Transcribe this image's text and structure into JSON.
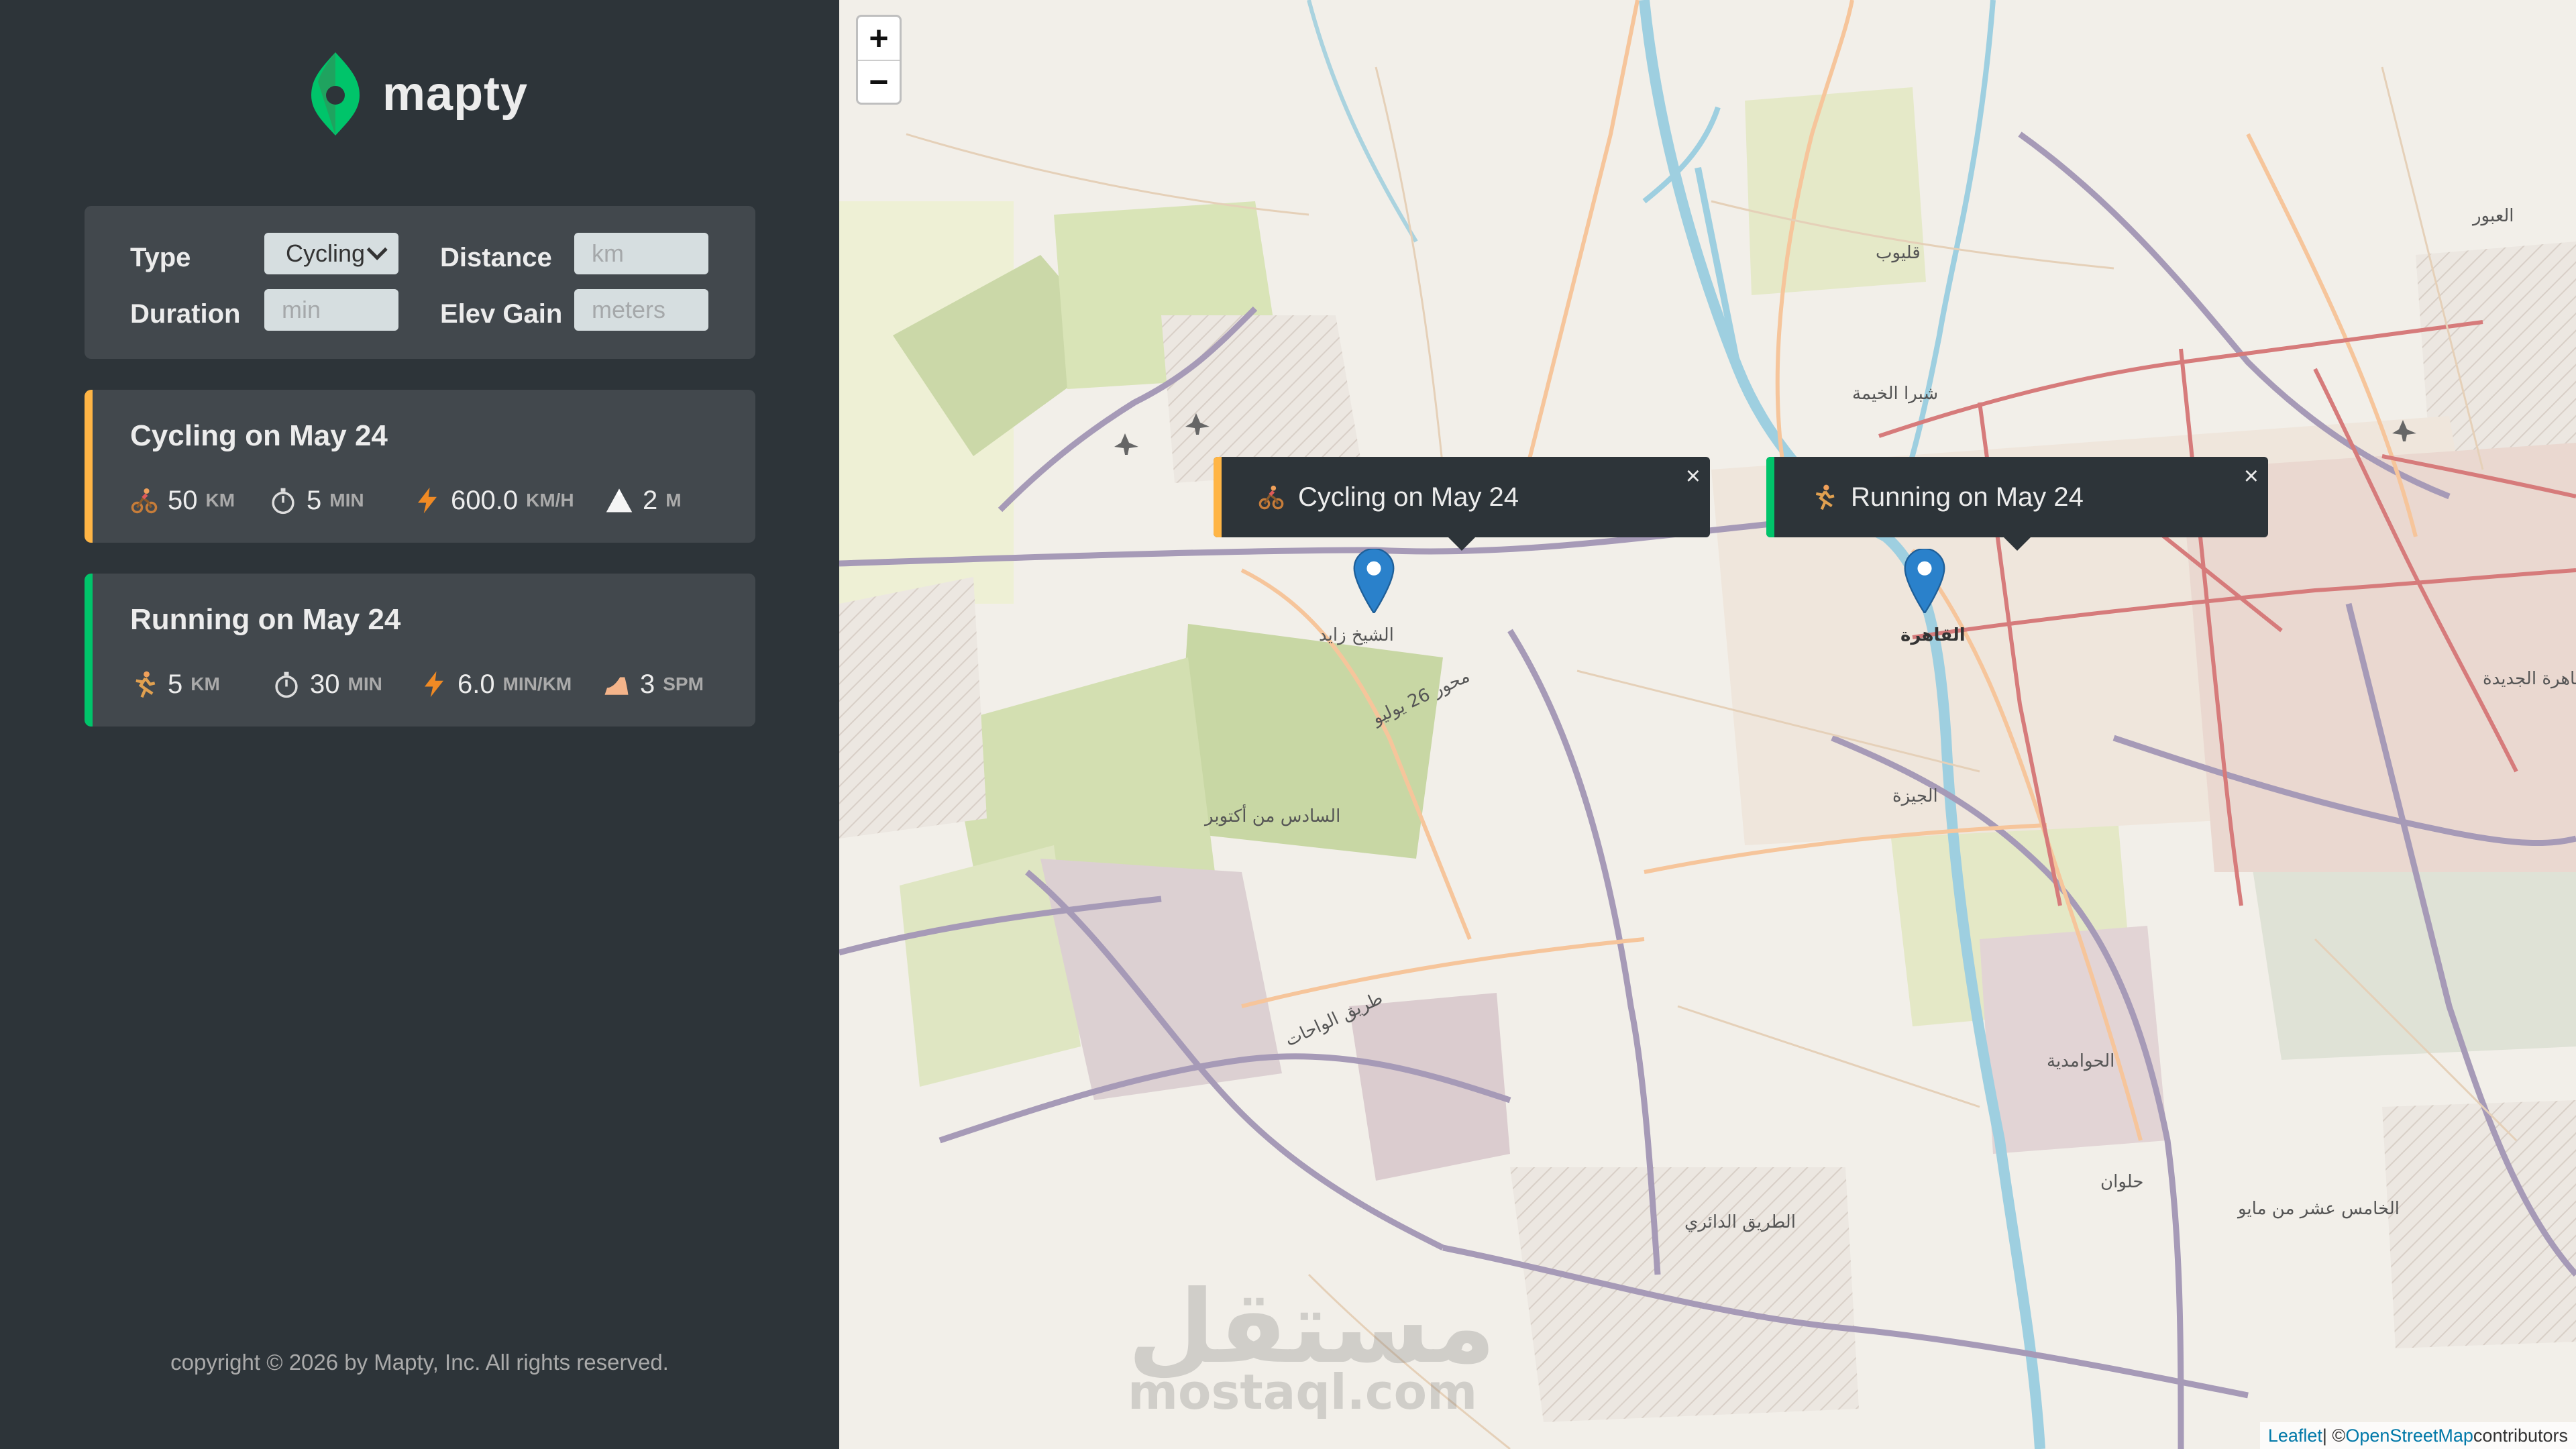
{
  "app": {
    "name": "mapty"
  },
  "form": {
    "type_label": "Type",
    "type_value": "Cycling",
    "distance_label": "Distance",
    "distance_placeholder": "km",
    "duration_label": "Duration",
    "duration_placeholder": "min",
    "elev_label": "Elev Gain",
    "elev_placeholder": "meters"
  },
  "workouts": [
    {
      "title": "Cycling on May 24",
      "accent_color": "#ffb545",
      "icon": "cyclist-icon",
      "distance": "50",
      "distance_unit": "km",
      "duration": "5",
      "duration_unit": "min",
      "speed": "600.0",
      "speed_unit": "km/h",
      "elevation": "2",
      "elevation_unit": "m"
    },
    {
      "title": "Running on May 24",
      "accent_color": "#00c46a",
      "icon": "runner-icon",
      "distance": "5",
      "distance_unit": "km",
      "duration": "30",
      "duration_unit": "min",
      "pace": "6.0",
      "pace_unit": "min/km",
      "cadence": "3",
      "cadence_unit": "spm"
    }
  ],
  "footer": {
    "copyright": "copyright © 2026 by Mapty, Inc. All rights reserved."
  },
  "map": {
    "zoom_in": "+",
    "zoom_out": "−",
    "popups": [
      {
        "title": "Cycling on May 24",
        "accent_color": "#ffb545",
        "close": "×"
      },
      {
        "title": "Running on May 24",
        "accent_color": "#00c46a",
        "close": "×"
      }
    ],
    "labels": {
      "zayed": "الشيخ زايد",
      "cairo": "القاهرة",
      "giza": "الجيزة",
      "october": "السادس من أكتوبر",
      "helwan": "حلوان",
      "shubra": "شبرا الخيمة",
      "qalyub": "قليوب",
      "ring_road": "الطريق الدائري",
      "wahat": "طريق الواحات",
      "mehwar": "محور 26 يوليو",
      "obour": "العبور",
      "new_cairo": "القاهرة الجديدة",
      "hawamdia": "الحوامدية",
      "fifth": "الخامس عشر من مايو"
    },
    "watermark": {
      "arabic": "مستقل",
      "latin": "mostaql.com"
    },
    "attribution": {
      "leaflet": "Leaflet",
      "sep": " | © ",
      "osm": "OpenStreetMap",
      "suffix": " contributors"
    }
  },
  "colors": {
    "sidebar_bg": "#2d3439",
    "card_bg": "#42484d",
    "brand_green": "#00c46a",
    "brand_yellow": "#ffb545",
    "marker_blue": "#2a81cb"
  }
}
